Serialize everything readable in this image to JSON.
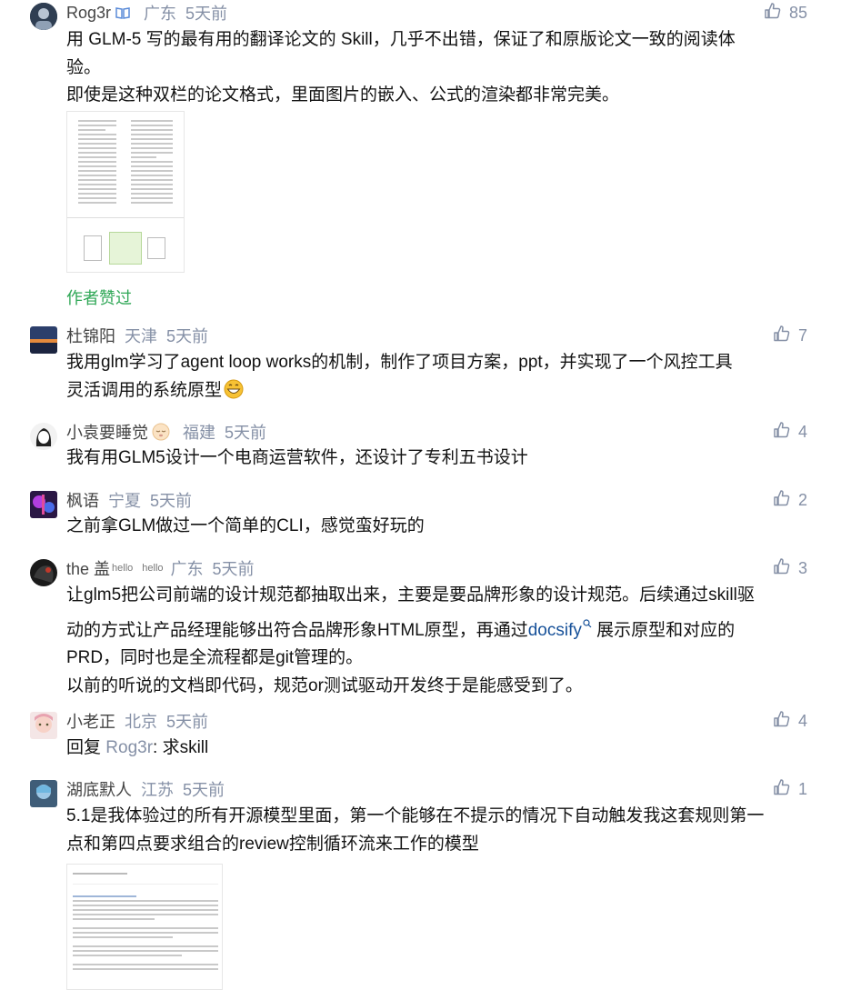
{
  "like_icon": "thumbs-up-icon",
  "comments": [
    {
      "author": "Rog3r",
      "badge_icon": "verified-book-icon",
      "location": "广东",
      "time": "5天前",
      "likes": "85",
      "lines": [
        "用 GLM-5 写的最有用的翻译论文的 Skill，几乎不出错，保证了和原版论文一致的阅读体",
        "验。",
        "即使是这种双栏的论文格式，里面图片的嵌入、公式的渲染都非常完美。"
      ],
      "author_liked": "作者赞过"
    },
    {
      "author": "杜锦阳",
      "location": "天津",
      "time": "5天前",
      "likes": "7",
      "lines": [
        "我用glm学习了agent loop works的机制，制作了项目方案，ppt，并实现了一个风控工具",
        "灵活调用的系统原型"
      ],
      "emoji": "grin-emoji"
    },
    {
      "author": "小袁要睡觉",
      "location": "福建",
      "time": "5天前",
      "likes": "4",
      "lines": [
        "我有用GLM5设计一个电商运营软件，还设计了专利五书设计"
      ]
    },
    {
      "author": "枫语",
      "location": "宁夏",
      "time": "5天前",
      "likes": "2",
      "lines": [
        "之前拿GLM做过一个简单的CLI，感觉蛮好玩的"
      ]
    },
    {
      "author": "the 盖",
      "author_sup1": "hello",
      "author_sup2": "hello",
      "location": "广东",
      "time": "5天前",
      "likes": "3",
      "line1": "让glm5把公司前端的设计规范都抽取出来，主要是要品牌形象的设计规范。后续通过skill驱",
      "line2_pre": "动的方式让产品经理能够出符合品牌形象HTML原型，再通过",
      "line2_link": "docsify",
      "line2_post": " 展示原型和对应的",
      "line3": "PRD，同时也是全流程都是git管理的。",
      "line4": "以前的听说的文档即代码，规范or测试驱动开发终于是能感受到了。"
    },
    {
      "author": "小老正",
      "location": "北京",
      "time": "5天前",
      "likes": "4",
      "reply_prefix": "回复 ",
      "reply_to": "Rog3r",
      "reply_text": ": 求skill"
    },
    {
      "author": "湖底默人",
      "location": "江苏",
      "time": "5天前",
      "likes": "1",
      "lines": [
        "5.1是我体验过的所有开源模型里面，第一个能够在不提示的情况下自动触发我这套规则第一",
        "点和第四点要求组合的review控制循环流来工作的模型"
      ]
    }
  ]
}
